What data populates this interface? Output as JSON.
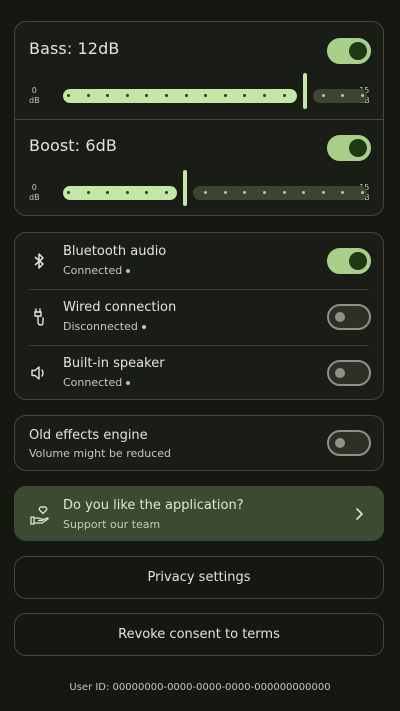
{
  "equalizer": {
    "bass": {
      "label": "Bass: 12dB",
      "enabled": true,
      "value": 12,
      "min": 0,
      "max": 15,
      "min_label": "0",
      "max_label": "15",
      "unit": "dB"
    },
    "boost": {
      "label": "Boost: 6dB",
      "enabled": true,
      "value": 6,
      "min": 0,
      "max": 15,
      "min_label": "0",
      "max_label": "15",
      "unit": "dB"
    }
  },
  "devices": [
    {
      "title": "Bluetooth audio",
      "status": "Connected",
      "status_color": "#a8d08b",
      "enabled": true,
      "icon": "bluetooth-icon"
    },
    {
      "title": "Wired connection",
      "status": "Disconnected",
      "status_color": "#f2b8b5",
      "enabled": false,
      "icon": "cable-icon"
    },
    {
      "title": "Built-in speaker",
      "status": "Connected",
      "status_color": "#a8d08b",
      "enabled": false,
      "icon": "speaker-icon"
    }
  ],
  "effects": {
    "title": "Old effects engine",
    "subtitle": "Volume might be reduced",
    "enabled": false
  },
  "support": {
    "title": "Do you like the application?",
    "subtitle": "Support our team",
    "icon": "heart-hand-icon"
  },
  "buttons": {
    "privacy": "Privacy settings",
    "revoke": "Revoke consent to terms"
  },
  "footer": {
    "user_id": "User ID: 00000000-0000-0000-0000-000000000000"
  },
  "colors": {
    "accent": "#a8d08b",
    "active_track": "#c4e6a6",
    "inactive_track": "#3b4531",
    "background": "#151711"
  }
}
